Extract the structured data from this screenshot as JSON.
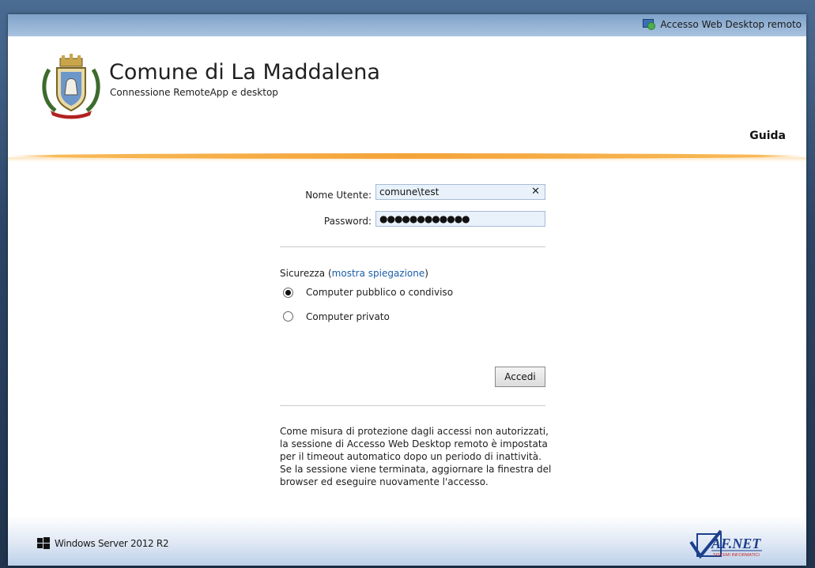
{
  "topbar": {
    "app_title": "Accesso Web Desktop remoto",
    "icon": "remote-desktop-icon"
  },
  "header": {
    "title": "Comune di La Maddalena",
    "subtitle": "Connessione RemoteApp e desktop",
    "help_link": "Guida"
  },
  "login": {
    "username_label": "Nome Utente:",
    "username_value": "comune\\test",
    "password_label": "Password:",
    "password_value": "●●●●●●●●●●●●"
  },
  "security": {
    "label_prefix": "Sicurezza (",
    "link": "mostra spiegazione",
    "label_suffix": ")",
    "options": [
      {
        "label": "Computer pubblico o condiviso",
        "selected": true
      },
      {
        "label": "Computer privato",
        "selected": false
      }
    ]
  },
  "submit_label": "Accedi",
  "note": "Come misura di protezione dagli accessi non autorizzati, la sessione di Accesso Web Desktop remoto è impostata per il timeout automatico dopo un periodo di inattività. Se la sessione viene terminata, aggiornare la finestra del browser ed eseguire nuovamente l'accesso.",
  "footer": {
    "os_label": "Windows Server 2012 R2",
    "vendor_logo_text": "AF.NET",
    "vendor_logo_subtext": "SISTEMI INFORMATICI"
  },
  "colors": {
    "accent_orange": "#f4a43a",
    "link_blue": "#1a5ea8",
    "topbar_blue": "#8fb0d6"
  }
}
